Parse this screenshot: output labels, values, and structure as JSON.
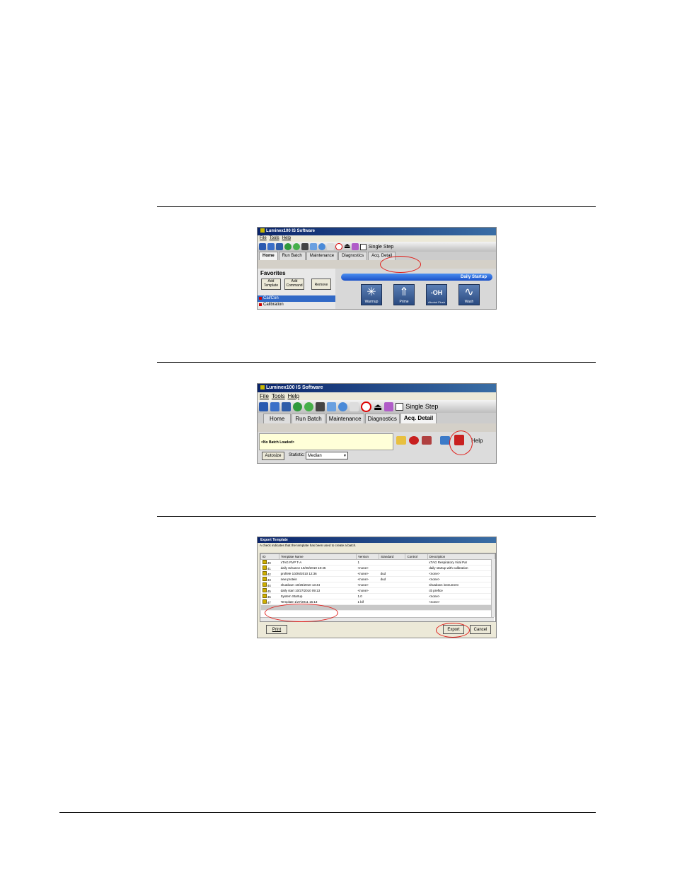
{
  "shot1": {
    "title": "Luminex100 IS Software",
    "menu": [
      "File",
      "Tools",
      "Help"
    ],
    "single_step": "Single Step",
    "tabs": [
      "Home",
      "Run Batch",
      "Maintenance",
      "Diagnostics",
      "Acq. Detail"
    ],
    "favorites_title": "Favorites",
    "buttons": [
      "Add Template",
      "Add Command",
      "Remove"
    ],
    "fav_items": [
      "Cal/Con",
      "Calibration"
    ],
    "daily_startup": "Daily Startup",
    "startup_icons": [
      "Warmup",
      "Prime",
      "Alcohol Flush",
      "Wash"
    ],
    "startup_glyphs": [
      "✳",
      "⇑",
      "-OH",
      "∿"
    ]
  },
  "shot2": {
    "title": "Luminex100 IS Software",
    "menu": [
      "File",
      "Tools",
      "Help"
    ],
    "single_step": "Single Step",
    "tabs": [
      "Home",
      "Run Batch",
      "Maintenance",
      "Diagnostics",
      "Acq. Detail"
    ],
    "batch_status": "<No Batch Loaded>",
    "help_label": "Help",
    "autosize": "Autosize",
    "statistic_label": "Statistic:",
    "statistic_value": "Median"
  },
  "shot3": {
    "title": "Export Template",
    "subtitle": "A check indicates that the template has been used to create a batch.",
    "columns": [
      "ID",
      "Template Name",
      "Version",
      "Standard",
      "Control",
      "Description"
    ],
    "rows": [
      {
        "id": "40",
        "name": "xTAG RVP T-A",
        "version": "1",
        "standard": "",
        "control": "",
        "description": "xTAG Respiratory Viral Par"
      },
      {
        "id": "41",
        "name": "daily st/nance 10/26/2010 10:45",
        "version": "<none>",
        "standard": "",
        "control": "",
        "description": "daily startup with calibration"
      },
      {
        "id": "42",
        "name": "profiele 10/26/2010 12:36",
        "version": "<none>",
        "standard": "dud",
        "control": "",
        "description": "<none>"
      },
      {
        "id": "43",
        "name": "new protein",
        "version": "<none>",
        "standard": "dud",
        "control": "",
        "description": "<none>"
      },
      {
        "id": "44",
        "name": "shutdown 10/26/2010 13:44",
        "version": "<none>",
        "standard": "",
        "control": "",
        "description": "shutdown instrument"
      },
      {
        "id": "45",
        "name": "daily start 10/27/2010 09:13",
        "version": "<none>",
        "standard": "",
        "control": "",
        "description": "cb prefice"
      },
      {
        "id": "46",
        "name": "System Startup",
        "version": "1.0",
        "standard": "",
        "control": "",
        "description": "<none>"
      },
      {
        "id": "47",
        "name": "Template 1/27/2011 15:13",
        "version": "1 bif",
        "standard": "",
        "control": "",
        "description": "<none>"
      }
    ],
    "print": "Print",
    "export": "Export",
    "cancel": "Cancel"
  }
}
